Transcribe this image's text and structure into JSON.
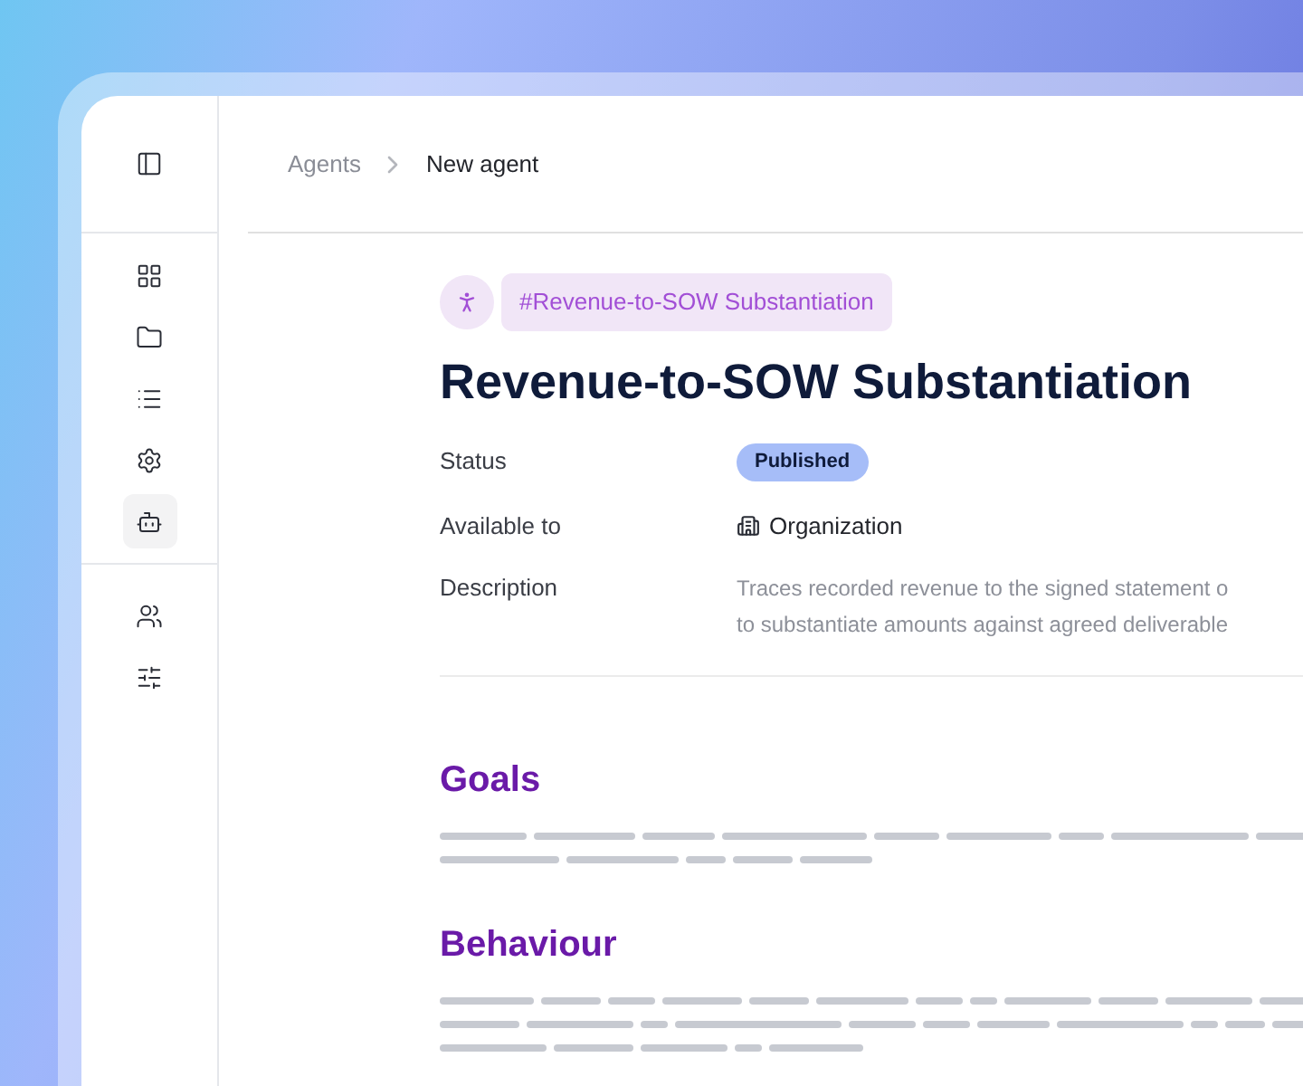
{
  "sidebar": {
    "items": [
      {
        "selected": false
      },
      {
        "selected": false
      },
      {
        "selected": false
      },
      {
        "selected": false
      },
      {
        "selected": false
      },
      {
        "selected": true
      },
      {
        "selected": false
      },
      {
        "selected": false
      }
    ]
  },
  "breadcrumb": [
    "Agents",
    "New agent"
  ],
  "tag": "#Revenue-to-SOW Substantiation",
  "title": "Revenue-to-SOW Substantiation",
  "fields": [
    {
      "kind": "badge",
      "label": "Status",
      "value": "Published"
    },
    {
      "kind": "icon_text",
      "label": "Available to",
      "value": "Organization"
    },
    {
      "kind": "text",
      "label": "Description",
      "lines": [
        "Traces recorded revenue to the signed statement o",
        "to substantiate amounts against agreed deliverable"
      ]
    }
  ],
  "sections": [
    {
      "heading": "Goals"
    },
    {
      "heading": "Behaviour"
    }
  ]
}
